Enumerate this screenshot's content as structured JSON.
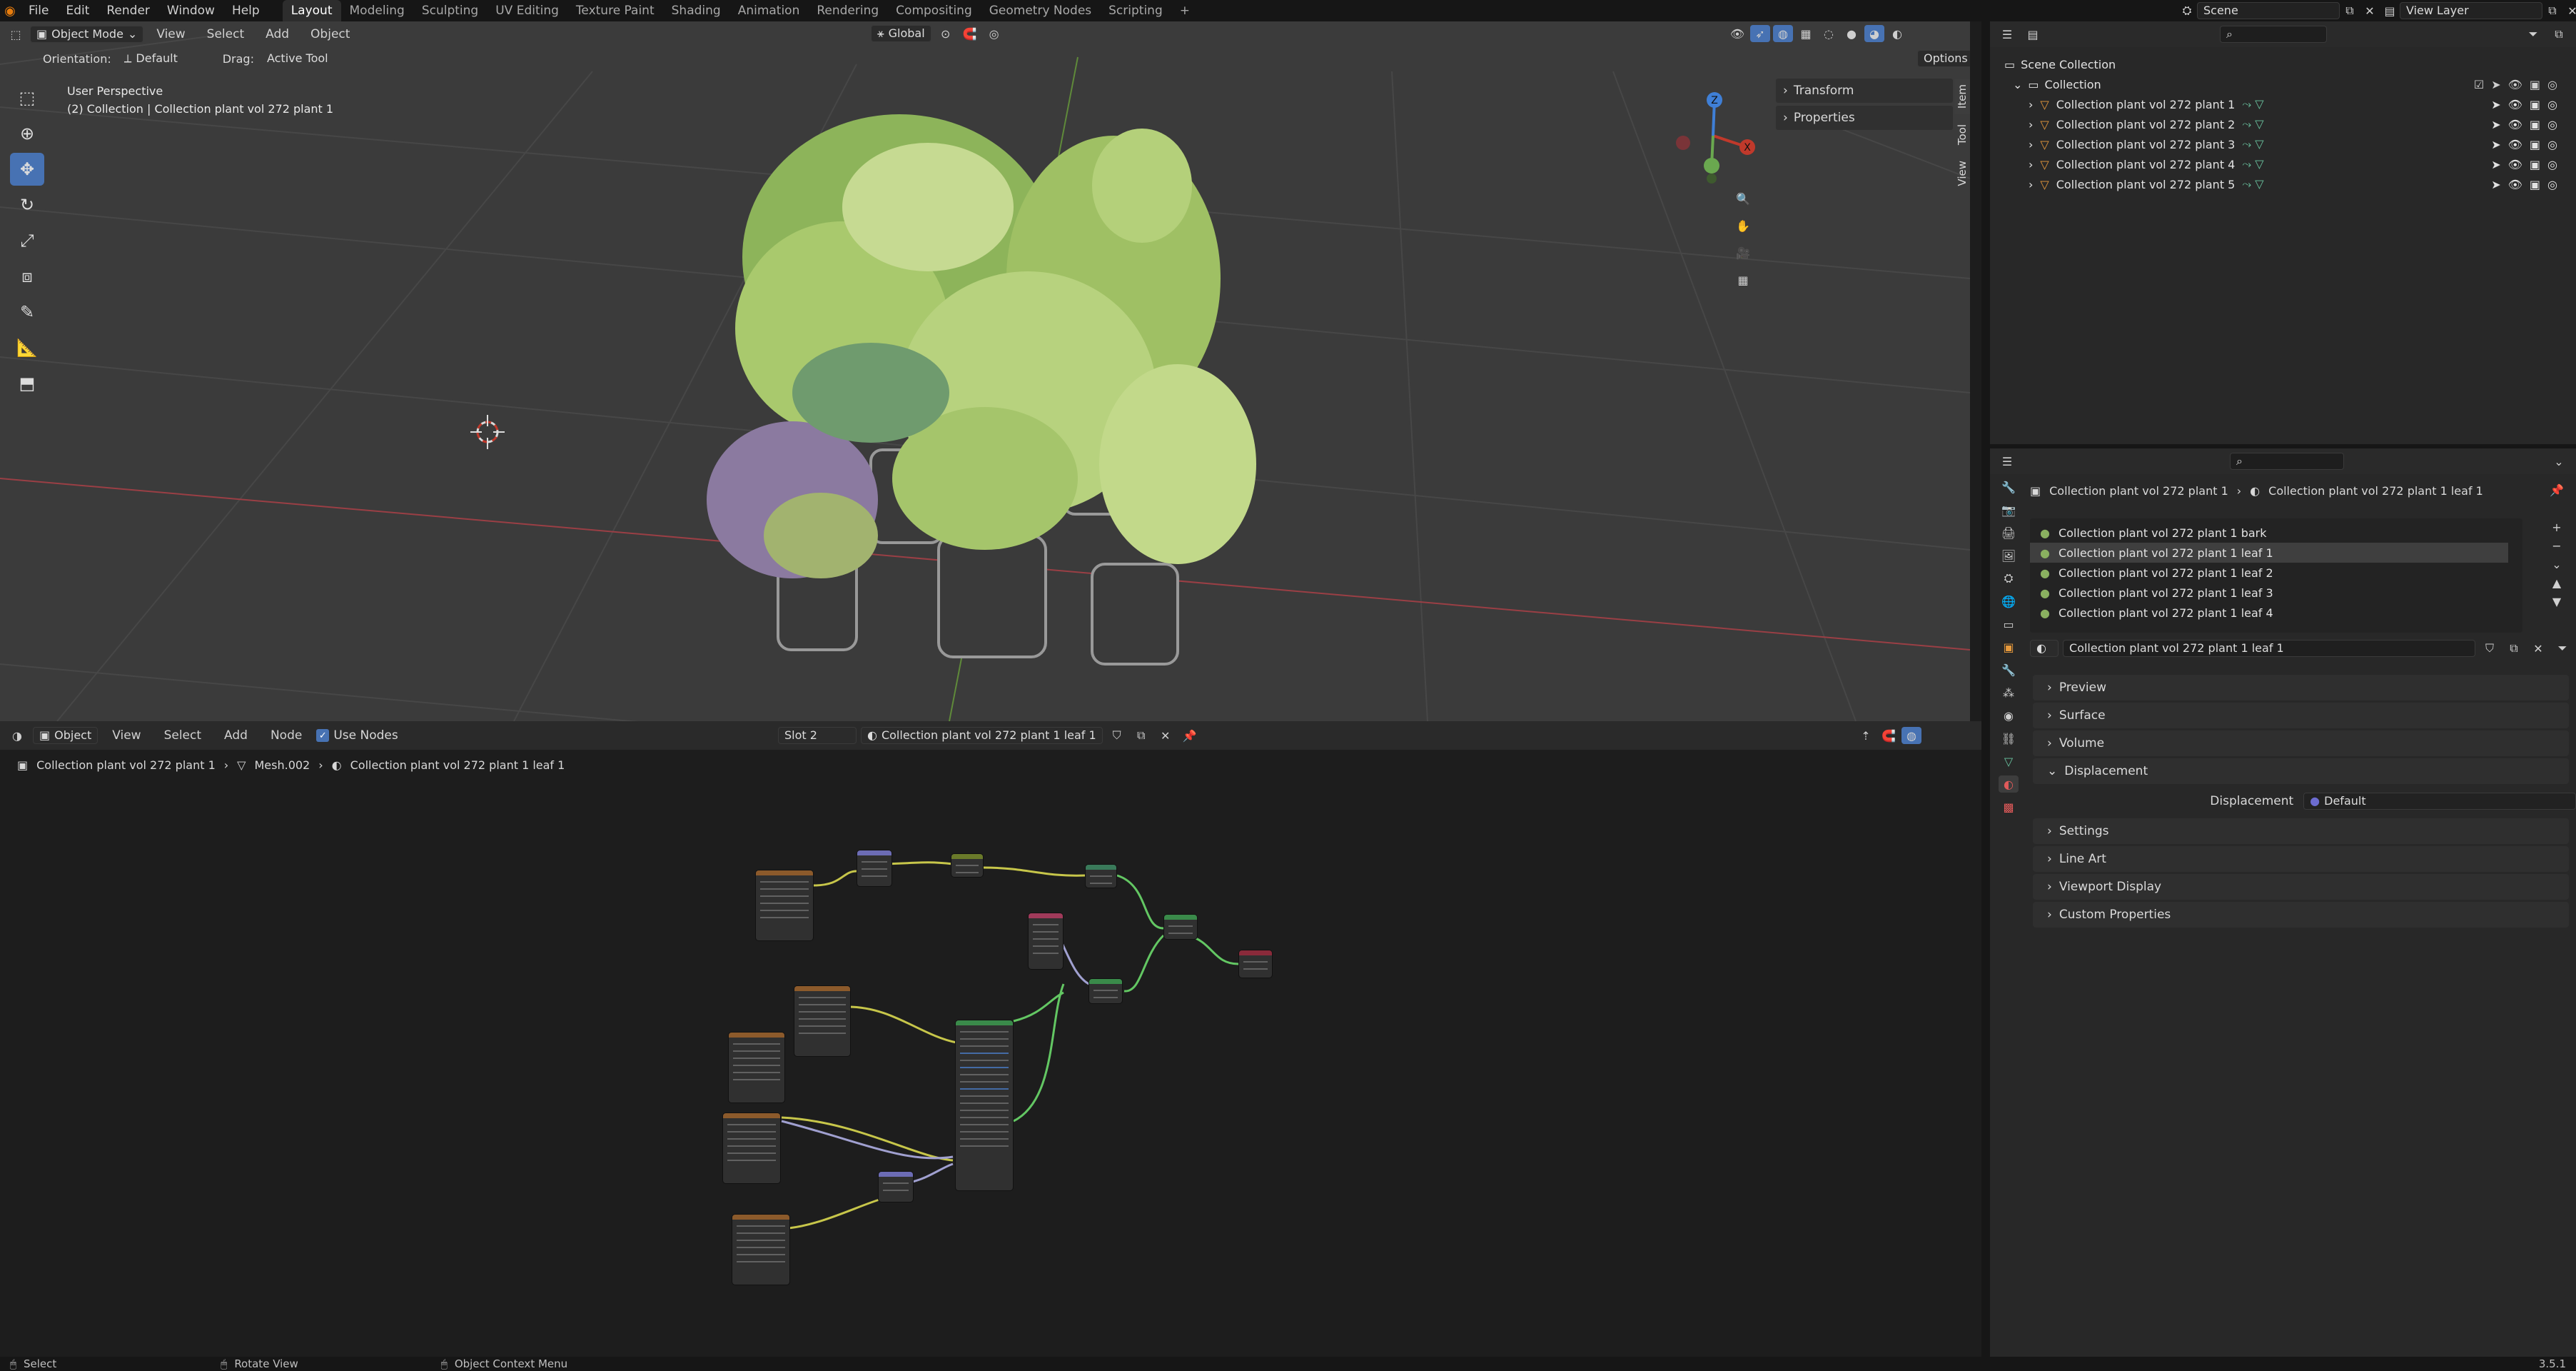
{
  "topbar": {
    "menus": [
      "File",
      "Edit",
      "Render",
      "Window",
      "Help"
    ],
    "workspaces": [
      "Layout",
      "Modeling",
      "Sculpting",
      "UV Editing",
      "Texture Paint",
      "Shading",
      "Animation",
      "Rendering",
      "Compositing",
      "Geometry Nodes",
      "Scripting"
    ],
    "active_workspace": "Layout",
    "add_tab": "+",
    "scene": "Scene",
    "view_layer": "View Layer"
  },
  "viewport": {
    "mode": "Object Mode",
    "menus": [
      "View",
      "Select",
      "Add",
      "Object"
    ],
    "orientation_label": "Orientation:",
    "orientation_value": "Default",
    "drag_label": "Drag:",
    "drag_value": "Active Tool",
    "transform_orientation": "Global",
    "options": "Options",
    "perspective_title": "User Perspective",
    "collection_info": "(2) Collection | Collection plant vol 272 plant 1",
    "sidebar_panels": [
      "Transform",
      "Properties"
    ],
    "sidebar_tabs": [
      "Item",
      "Tool",
      "View"
    ],
    "gizmo_axes": [
      "X",
      "Y",
      "Z"
    ]
  },
  "node_editor": {
    "editor_type": "Object",
    "menus": [
      "View",
      "Select",
      "Add",
      "Node"
    ],
    "use_nodes_label": "Use Nodes",
    "slot": "Slot 2",
    "material": "Collection plant vol 272 plant 1 leaf 1",
    "breadcrumb": [
      "Collection plant vol 272 plant 1",
      "Mesh.002",
      "Collection plant vol 272 plant 1 leaf 1"
    ]
  },
  "outliner": {
    "root": "Scene Collection",
    "collection": "Collection",
    "items": [
      "Collection plant vol 272 plant 1",
      "Collection plant vol 272 plant 2",
      "Collection plant vol 272 plant 3",
      "Collection plant vol 272 plant 4",
      "Collection plant vol 272 plant 5"
    ]
  },
  "properties": {
    "breadcrumb_object": "Collection plant vol 272 plant 1",
    "breadcrumb_material": "Collection plant vol 272 plant 1 leaf 1",
    "material_slots": [
      "Collection plant vol 272 plant 1 bark",
      "Collection plant vol 272 plant 1 leaf 1",
      "Collection plant vol 272 plant 1 leaf 2",
      "Collection plant vol 272 plant 1 leaf 3",
      "Collection plant vol 272 plant 1 leaf 4"
    ],
    "active_slot": 1,
    "material_name": "Collection plant vol 272 plant 1 leaf 1",
    "panels": [
      "Preview",
      "Surface",
      "Volume",
      "Displacement",
      "Settings",
      "Line Art",
      "Viewport Display",
      "Custom Properties"
    ],
    "displacement_label": "Displacement",
    "displacement_value": "Default"
  },
  "statusbar": {
    "items": [
      "Select",
      "Rotate View",
      "Object Context Menu"
    ],
    "version": "3.5.1"
  },
  "colors": {
    "accent": "#4772b3",
    "x_axis": "#b33c3c",
    "y_axis": "#6aa84f",
    "z_axis": "#3f7fd6"
  }
}
